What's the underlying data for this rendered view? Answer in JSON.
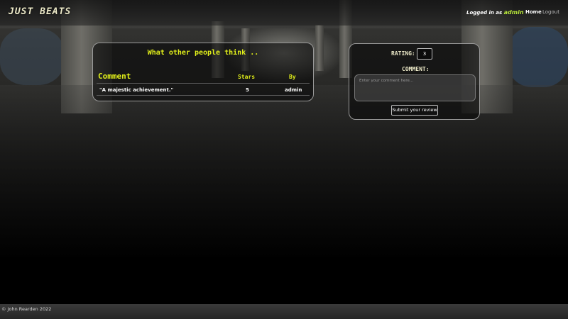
{
  "header": {
    "logo": "JUST BEATS",
    "login_prefix": "Logged in as",
    "username": "admin",
    "nav": {
      "home": "Home",
      "logout": "Logout"
    }
  },
  "reviews": {
    "title": "What other people think ..",
    "columns": {
      "comment": "Comment",
      "stars": "Stars",
      "by": "By"
    },
    "rows": [
      {
        "comment": "\"A majestic achievement.\"",
        "stars": "5",
        "by": "admin"
      }
    ]
  },
  "review_form": {
    "rating_label": "RATING:",
    "rating_value": "3",
    "comment_label": "COMMENT:",
    "comment_placeholder": "Enter your comment here...",
    "submit_label": "Submit your review"
  },
  "footer": {
    "copyright": "© John Rearden 2022"
  },
  "colors": {
    "accent": "#e2f01a",
    "username": "#b7e53b",
    "background": "#000000"
  }
}
